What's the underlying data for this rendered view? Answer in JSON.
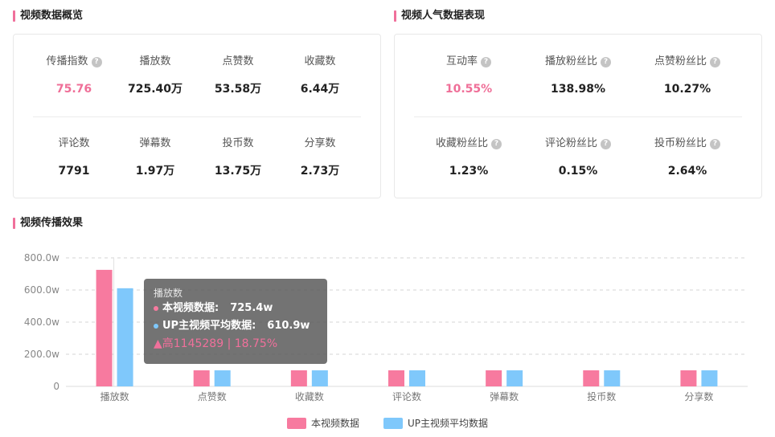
{
  "overview": {
    "title": "视频数据概览",
    "row1": [
      {
        "label": "传播指数",
        "value": "75.76",
        "help": true,
        "highlight": true
      },
      {
        "label": "播放数",
        "value": "725.40万",
        "help": false,
        "highlight": false
      },
      {
        "label": "点赞数",
        "value": "53.58万",
        "help": false,
        "highlight": false
      },
      {
        "label": "收藏数",
        "value": "6.44万",
        "help": false,
        "highlight": false
      }
    ],
    "row2": [
      {
        "label": "评论数",
        "value": "7791"
      },
      {
        "label": "弹幕数",
        "value": "1.97万"
      },
      {
        "label": "投币数",
        "value": "13.75万"
      },
      {
        "label": "分享数",
        "value": "2.73万"
      }
    ]
  },
  "popularity": {
    "title": "视频人气数据表现",
    "row1": [
      {
        "label": "互动率",
        "value": "10.55%",
        "highlight": true
      },
      {
        "label": "播放粉丝比",
        "value": "138.98%",
        "highlight": false
      },
      {
        "label": "点赞粉丝比",
        "value": "10.27%",
        "highlight": false
      }
    ],
    "row2": [
      {
        "label": "收藏粉丝比",
        "value": "1.23%"
      },
      {
        "label": "评论粉丝比",
        "value": "0.15%"
      },
      {
        "label": "投币粉丝比",
        "value": "2.64%"
      }
    ],
    "help_glyph": "?"
  },
  "spread": {
    "title": "视频传播效果"
  },
  "colors": {
    "accent": "#f0709b",
    "series_video": "#f77a9f",
    "series_avg": "#7fc8fb"
  },
  "chart_data": {
    "type": "bar",
    "categories": [
      "播放数",
      "点赞数",
      "收藏数",
      "评论数",
      "弹幕数",
      "投币数",
      "分享数"
    ],
    "series": [
      {
        "name": "本视频数据",
        "values": [
          725.4,
          100,
          100,
          100,
          100,
          100,
          100
        ]
      },
      {
        "name": "UP主视频平均数据",
        "values": [
          610.9,
          100,
          100,
          100,
          100,
          100,
          100
        ]
      }
    ],
    "yticks": [
      "0",
      "200.0w",
      "400.0w",
      "600.0w",
      "800.0w"
    ],
    "ylim": [
      0,
      800
    ],
    "grid": true,
    "legend": "bottom-center"
  },
  "tooltip": {
    "title": "播放数",
    "row1_label": "本视频数据:",
    "row1_value": "725.4w",
    "row2_label": "UP主视频平均数据:",
    "row2_value": "610.9w",
    "diff": "▲高1145289 | 18.75%"
  }
}
